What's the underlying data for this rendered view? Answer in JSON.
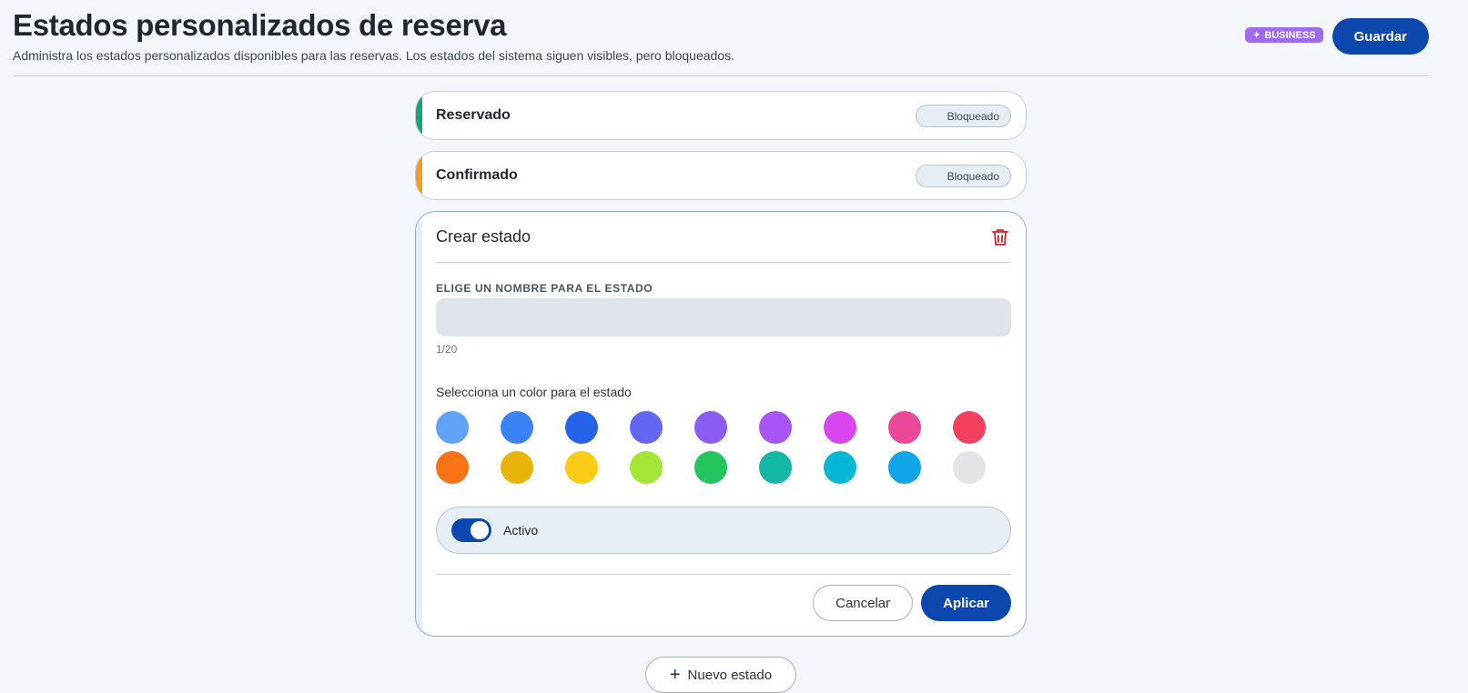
{
  "header": {
    "title": "Estados personalizados de reserva",
    "subtitle": "Administra los estados personalizados disponibles para las reservas. Los estados del sistema siguen visibles, pero bloqueados.",
    "badge": "BUSINESS",
    "badge_icon": "sparkle-icon",
    "save_label": "Guardar"
  },
  "system_states": [
    {
      "name": "Reservado",
      "color": "#1aa37a",
      "locked_label": "Bloqueado"
    },
    {
      "name": "Confirmado",
      "color": "#f0a020",
      "locked_label": "Bloqueado"
    }
  ],
  "editor": {
    "title": "Crear estado",
    "delete_icon": "trash-icon",
    "name_label": "ELIGE UN NOMBRE PARA EL ESTADO",
    "name_value": "",
    "name_placeholder": "",
    "counter": "1/20",
    "color_label": "Selecciona un color para el estado",
    "colors": [
      "#5fa3f7",
      "#3b82f6",
      "#2563eb",
      "#6366f1",
      "#8b5cf6",
      "#a855f7",
      "#d946ef",
      "#ec4899",
      "#f43f5e",
      "#f97316",
      "#eab308",
      "#facc15",
      "#a3e635",
      "#22c55e",
      "#14b8a6",
      "#06b6d4",
      "#0ea5e9",
      "#e2e4e8"
    ],
    "active_label": "Activo",
    "active_on": true,
    "cancel_label": "Cancelar",
    "apply_label": "Aplicar"
  },
  "new_state_label": "Nuevo estado",
  "new_state_icon": "plus-icon",
  "accent_color": "#0b47ad"
}
